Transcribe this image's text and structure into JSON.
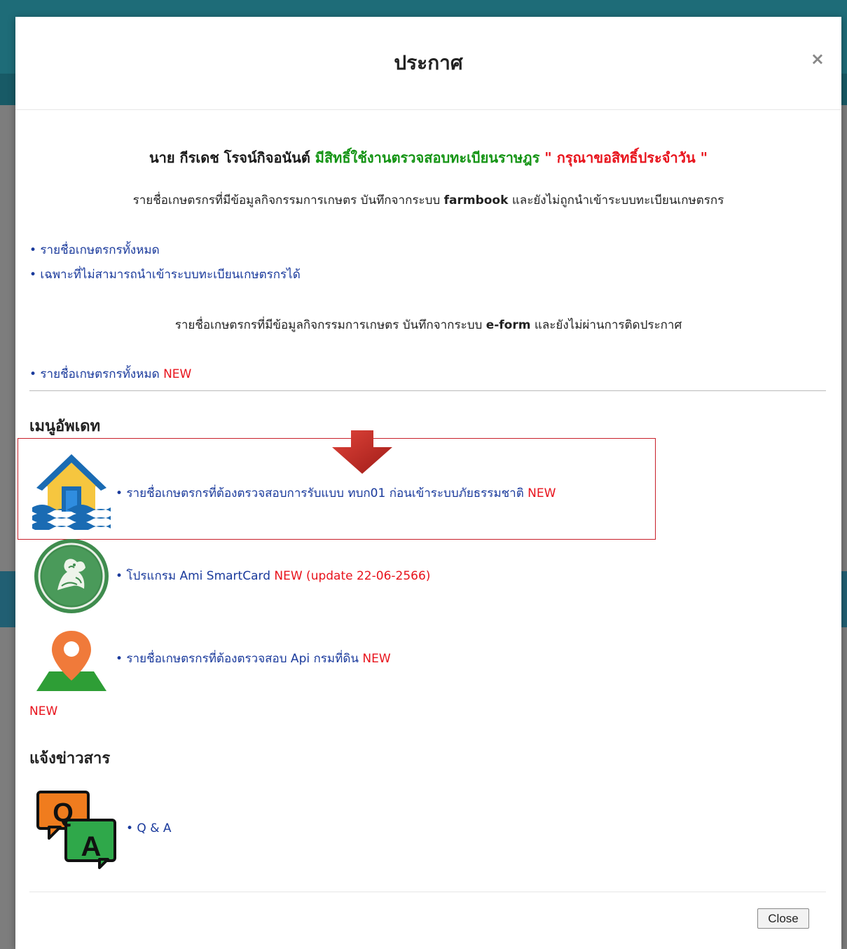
{
  "modal": {
    "title": "ประกาศ",
    "close_icon": "×",
    "headline": {
      "name": "นาย กีรเดช โรจน์กิจอนันต์",
      "right": " มีสิทธิ์ใช้งานตรวจสอบทะเบียนราษฎร",
      "request": " \" กรุณาขอสิทธิ์ประจำวัน \""
    },
    "farmbook": {
      "pre": "รายชื่อเกษตรกรที่มีข้อมูลกิจกรรมการเกษตร บันทึกจากระบบ ",
      "bold": "farmbook",
      "post": " และยังไม่ถูกนำเข้าระบบทะเบียนเกษตรกร",
      "links": [
        "• รายชื่อเกษตรกรทั้งหมด",
        "• เฉพาะที่ไม่สามารถนำเข้าระบบทะเบียนเกษตรกรได้"
      ]
    },
    "eform": {
      "pre": "รายชื่อเกษตรกรที่มีข้อมูลกิจกรรมการเกษตร บันทึกจากระบบ ",
      "bold": "e-form",
      "post": " และยังไม่ผ่านการติดประกาศ",
      "link": "• รายชื่อเกษตรกรทั้งหมด",
      "link_new": " NEW"
    },
    "update_menu": {
      "title": "เมนูอัพเดท",
      "items": [
        {
          "icon": "flood-house-icon",
          "text": "• รายชื่อเกษตรกรที่ต้องตรวจสอบการรับแบบ ทบก01 ก่อนเข้าระบบภัยธรรมชาติ",
          "badge": " NEW"
        },
        {
          "icon": "department-seal-icon",
          "text": "• โปรแกรม Ami SmartCard",
          "badge": " NEW (update 22-06-2566)"
        },
        {
          "icon": "map-pin-icon",
          "text": "• รายชื่อเกษตรกรที่ต้องตรวจสอบ Api กรมที่ดิน",
          "badge": " NEW"
        }
      ],
      "orphan_new": "NEW"
    },
    "news": {
      "title": "แจ้งข่าวสาร",
      "qa_icon_q": "Q",
      "qa_icon_a": "A",
      "qa_link": "• Q & A"
    },
    "close_button": "Close"
  }
}
